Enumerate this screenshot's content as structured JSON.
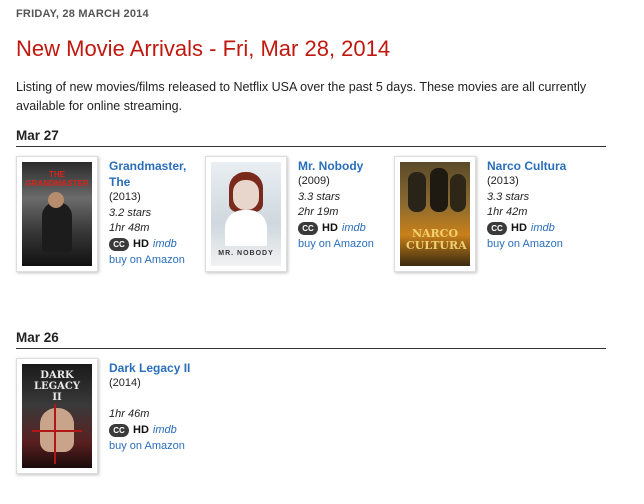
{
  "post": {
    "date_header": "FRIDAY, 28 MARCH 2014",
    "title": "New Movie Arrivals - Fri, Mar 28, 2014",
    "intro": "Listing of new movies/films released to Netflix USA over the past 5 days. These movies are all currently available for online streaming."
  },
  "sections": [
    {
      "date": "Mar 27",
      "movies": [
        {
          "title": "Grandmaster, The",
          "year": "(2013)",
          "stars": "3.2 stars",
          "runtime": "1hr 48m",
          "cc": "CC",
          "hd": "HD",
          "imdb": "imdb",
          "amazon": "buy on Amazon",
          "poster_text": "THE GRANDMASTER"
        },
        {
          "title": "Mr. Nobody",
          "year": "(2009)",
          "stars": "3.3 stars",
          "runtime": "2hr 19m",
          "cc": "CC",
          "hd": "HD",
          "imdb": "imdb",
          "amazon": "buy on Amazon",
          "poster_text": "MR. NOBODY"
        },
        {
          "title": "Narco Cultura",
          "year": "(2013)",
          "stars": "3.3 stars",
          "runtime": "1hr 42m",
          "cc": "CC",
          "hd": "HD",
          "imdb": "imdb",
          "amazon": "buy on Amazon",
          "poster_text": "NARCO CULTURA"
        }
      ]
    },
    {
      "date": "Mar 26",
      "movies": [
        {
          "title": "Dark Legacy II",
          "year": "(2014)",
          "stars": "",
          "runtime": "1hr 46m",
          "cc": "CC",
          "hd": "HD",
          "imdb": "imdb",
          "amazon": "buy on Amazon",
          "poster_text": "DARK LEGACY II"
        }
      ]
    }
  ],
  "colors": {
    "title_red": "#c0180e",
    "link_blue": "#2a6ebb"
  }
}
